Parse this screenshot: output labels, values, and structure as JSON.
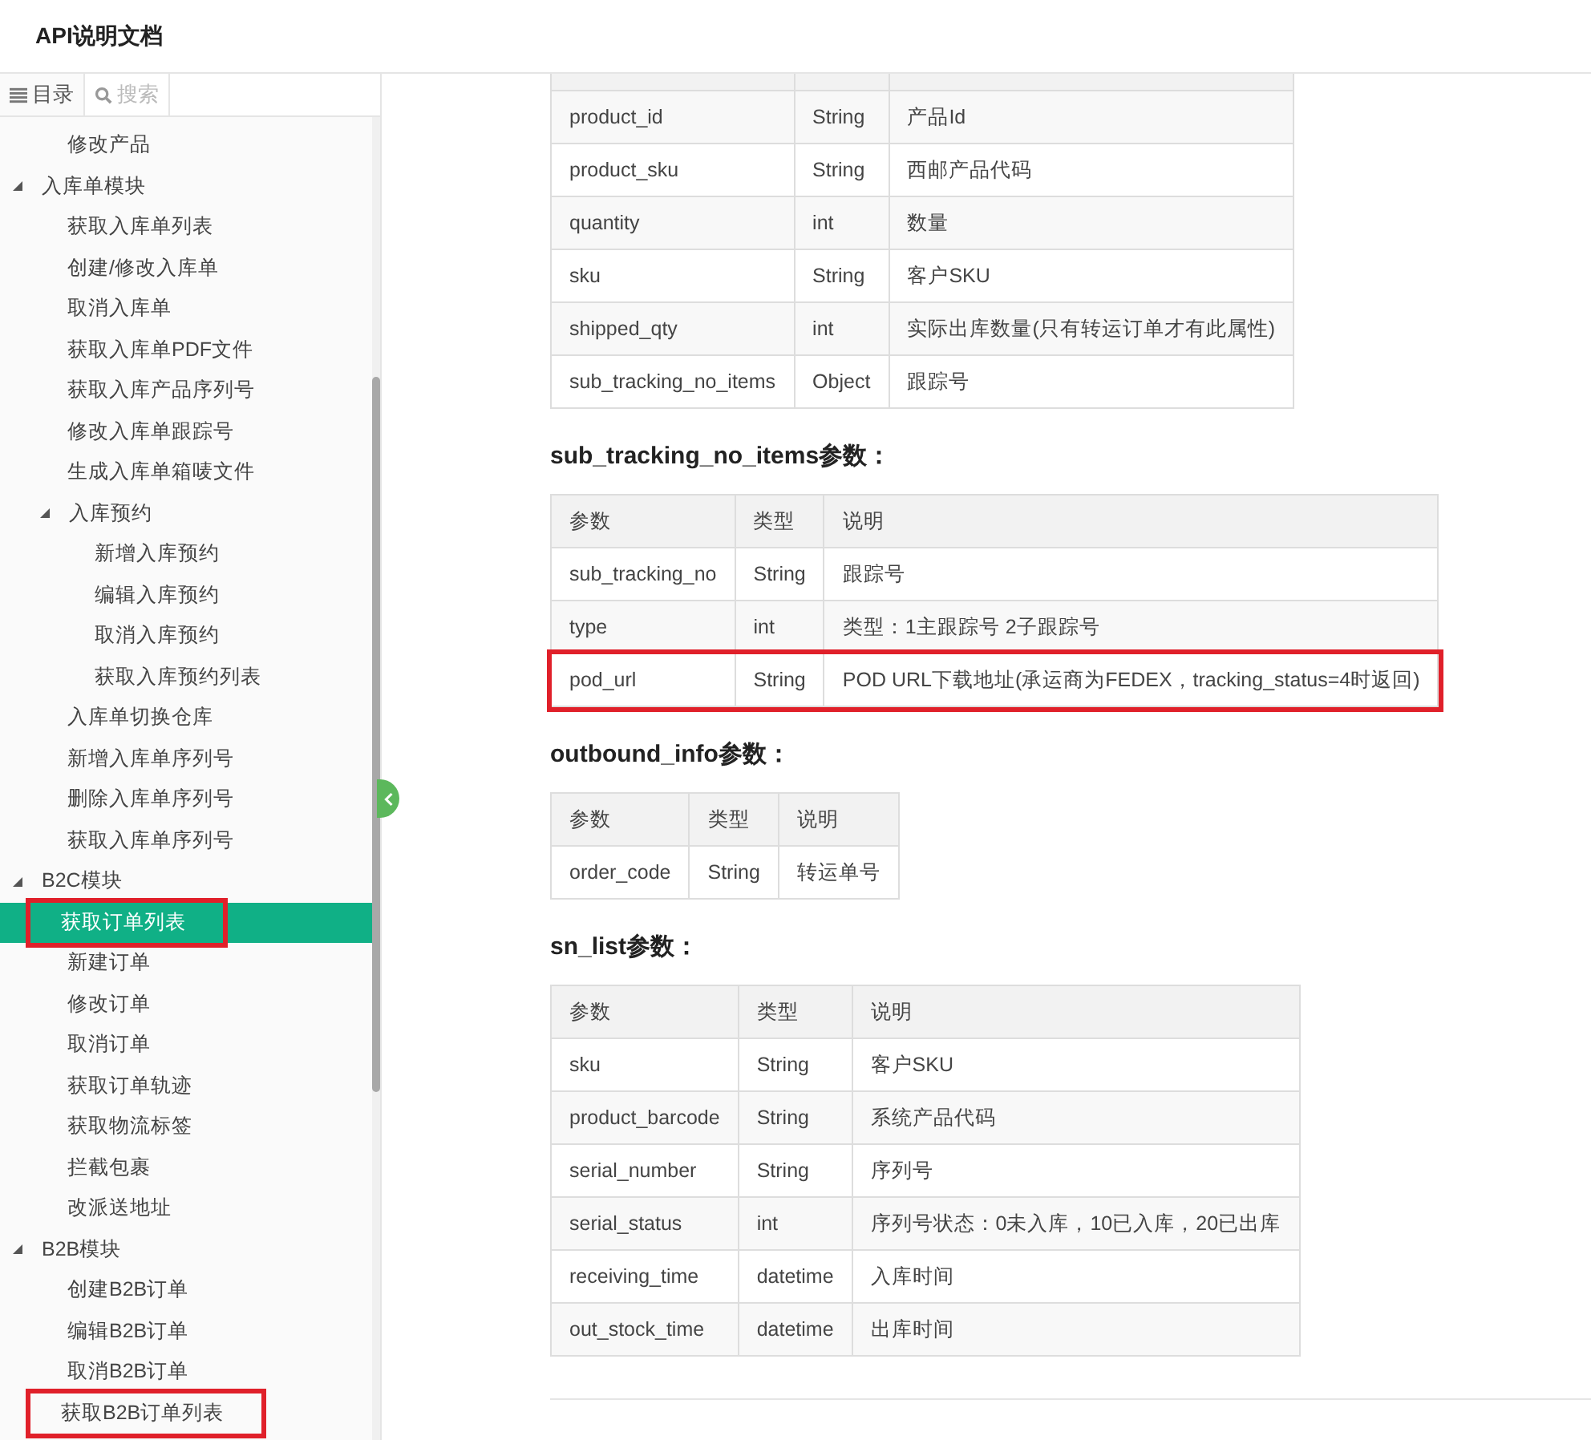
{
  "header": {
    "title": "API说明文档"
  },
  "sidebar": {
    "tabs": [
      {
        "label": "目录",
        "kind": "toc",
        "selected": true
      },
      {
        "label": "搜索",
        "kind": "search",
        "selected": false
      }
    ],
    "continued_items": [
      {
        "label": "修改产品",
        "selected": false,
        "highlighted": false
      }
    ],
    "items": [
      {
        "label": "入库单模块",
        "expanded": true,
        "children": [
          {
            "label": "获取入库单列表",
            "selected": false,
            "highlighted": false
          },
          {
            "label": "创建/修改入库单",
            "selected": false,
            "highlighted": false
          },
          {
            "label": "取消入库单",
            "selected": false,
            "highlighted": false
          },
          {
            "label": "获取入库单PDF文件",
            "selected": false,
            "highlighted": false
          },
          {
            "label": "获取入库产品序列号",
            "selected": false,
            "highlighted": false
          },
          {
            "label": "修改入库单跟踪号",
            "selected": false,
            "highlighted": false
          },
          {
            "label": "生成入库单箱唛文件",
            "selected": false,
            "highlighted": false
          },
          {
            "label": "入库预约",
            "expanded": true,
            "children": [
              {
                "label": "新增入库预约",
                "selected": false,
                "highlighted": false
              },
              {
                "label": "编辑入库预约",
                "selected": false,
                "highlighted": false
              },
              {
                "label": "取消入库预约",
                "selected": false,
                "highlighted": false
              },
              {
                "label": "获取入库预约列表",
                "selected": false,
                "highlighted": false
              }
            ]
          },
          {
            "label": "入库单切换仓库",
            "selected": false,
            "highlighted": false
          },
          {
            "label": "新增入库单序列号",
            "selected": false,
            "highlighted": false
          },
          {
            "label": "删除入库单序列号",
            "selected": false,
            "highlighted": false
          },
          {
            "label": "获取入库单序列号",
            "selected": false,
            "highlighted": false
          }
        ]
      },
      {
        "label": "B2C模块",
        "expanded": true,
        "children": [
          {
            "label": "获取订单列表",
            "selected": true,
            "highlighted": true
          },
          {
            "label": "新建订单",
            "selected": false,
            "highlighted": false
          },
          {
            "label": "修改订单",
            "selected": false,
            "highlighted": false
          },
          {
            "label": "取消订单",
            "selected": false,
            "highlighted": false
          },
          {
            "label": "获取订单轨迹",
            "selected": false,
            "highlighted": false
          },
          {
            "label": "获取物流标签",
            "selected": false,
            "highlighted": false
          },
          {
            "label": "拦截包裹",
            "selected": false,
            "highlighted": false
          },
          {
            "label": "改派送地址",
            "selected": false,
            "highlighted": false
          }
        ]
      },
      {
        "label": "B2B模块",
        "expanded": true,
        "children": [
          {
            "label": "创建B2B订单",
            "selected": false,
            "highlighted": false
          },
          {
            "label": "编辑B2B订单",
            "selected": false,
            "highlighted": false
          },
          {
            "label": "取消B2B订单",
            "selected": false,
            "highlighted": false
          },
          {
            "label": "获取B2B订单列表",
            "selected": false,
            "highlighted": true
          }
        ]
      }
    ]
  },
  "content": {
    "sections": [
      {
        "rows": [
          {
            "cells": [
              "product_id",
              "String",
              "产品Id"
            ],
            "highlighted": false
          },
          {
            "cells": [
              "product_sku",
              "String",
              "西邮产品代码"
            ],
            "highlighted": false
          },
          {
            "cells": [
              "quantity",
              "int",
              "数量"
            ],
            "highlighted": false
          },
          {
            "cells": [
              "sku",
              "String",
              "客户SKU"
            ],
            "highlighted": false
          },
          {
            "cells": [
              "shipped_qty",
              "int",
              "实际出库数量(只有转运订单才有此属性)"
            ],
            "highlighted": false
          },
          {
            "cells": [
              "sub_tracking_no_items",
              "Object",
              "跟踪号"
            ],
            "highlighted": false
          }
        ]
      },
      {
        "heading": "sub_tracking_no_items参数：",
        "columns": [
          "参数",
          "类型",
          "说明"
        ],
        "rows": [
          {
            "cells": [
              "sub_tracking_no",
              "String",
              "跟踪号"
            ],
            "highlighted": false
          },
          {
            "cells": [
              "type",
              "int",
              "类型：1主跟踪号 2子跟踪号"
            ],
            "highlighted": false
          },
          {
            "cells": [
              "pod_url",
              "String",
              "POD URL下载地址(承运商为FEDEX，tracking_status=4时返回)"
            ],
            "highlighted": true
          }
        ]
      },
      {
        "heading": "outbound_info参数：",
        "columns": [
          "参数",
          "类型",
          "说明"
        ],
        "rows": [
          {
            "cells": [
              "order_code",
              "String",
              "转运单号"
            ],
            "highlighted": false
          }
        ]
      },
      {
        "heading": "sn_list参数：",
        "columns": [
          "参数",
          "类型",
          "说明"
        ],
        "rows": [
          {
            "cells": [
              "sku",
              "String",
              "客户SKU"
            ],
            "highlighted": false
          },
          {
            "cells": [
              "product_barcode",
              "String",
              "系统产品代码"
            ],
            "highlighted": false
          },
          {
            "cells": [
              "serial_number",
              "String",
              "序列号"
            ],
            "highlighted": false
          },
          {
            "cells": [
              "serial_status",
              "int",
              "序列号状态：0未入库，10已入库，20已出库"
            ],
            "highlighted": false
          },
          {
            "cells": [
              "receiving_time",
              "datetime",
              "入库时间"
            ],
            "highlighted": false
          },
          {
            "cells": [
              "out_stock_time",
              "datetime",
              "出库时间"
            ],
            "highlighted": false
          }
        ]
      }
    ]
  }
}
